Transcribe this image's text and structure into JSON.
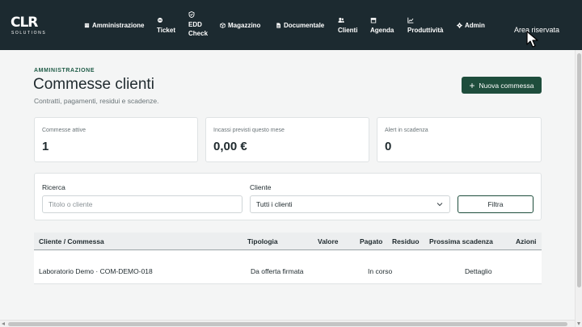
{
  "logo": {
    "mark": "CLR",
    "sub": "SOLUTIONS"
  },
  "nav": {
    "amministrazione": "Amministrazione",
    "ticket": "Ticket",
    "edd_line1": "EDD",
    "edd_line2": "Check",
    "magazzino": "Magazzino",
    "documentale": "Documentale",
    "clienti": "Clienti",
    "agenda": "Agenda",
    "produttivita": "Produttività",
    "admin": "Admin",
    "area_riservata": "Area riservata"
  },
  "header": {
    "eyebrow": "AMMINISTRAZIONE",
    "title": "Commesse clienti",
    "subtitle": "Contratti, pagamenti, residui e scadenze.",
    "new_button": "Nuova commessa"
  },
  "kpis": [
    {
      "label": "Commesse attive",
      "value": "1"
    },
    {
      "label": "Incassi previsti questo mese",
      "value": "0,00 €"
    },
    {
      "label": "Alert in scadenza",
      "value": "0"
    }
  ],
  "filters": {
    "search_label": "Ricerca",
    "search_placeholder": "Titolo o cliente",
    "client_label": "Cliente",
    "client_selected": "Tutti i clienti",
    "filter_button": "Filtra"
  },
  "table": {
    "headers": [
      "Cliente / Commessa",
      "Tipologia",
      "Valore",
      "Pagato",
      "Residuo",
      "Prossima scadenza",
      "Azioni"
    ],
    "rows": [
      {
        "cliente": "Laboratorio Demo · COM-DEMO-018",
        "tipologia": "Da offerta firmata",
        "valore": "",
        "pagato": "In corso",
        "residuo": "",
        "scadenza": "Dettaglio",
        "azioni": ""
      }
    ]
  },
  "colors": {
    "navbar": "#1c2a30",
    "accent": "#1e4d3c",
    "eyebrow": "#1e5b46"
  }
}
